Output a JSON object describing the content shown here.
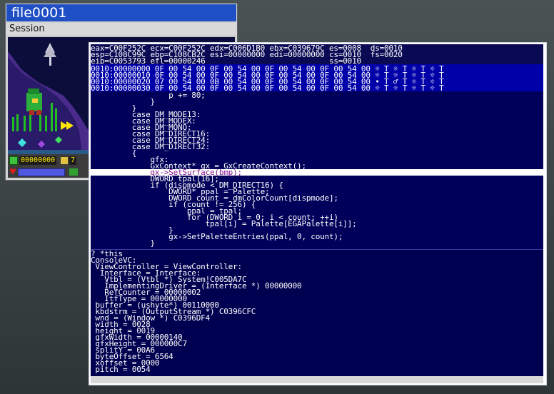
{
  "back_window": {
    "title": "file0001",
    "menu_label": "Session",
    "hud": {
      "score_left": "00000000",
      "score_right": "7"
    }
  },
  "debugger": {
    "registers": [
      "eax=C00F252C ecx=C00F252C edx=C006D1B0 ebx=C039679C es=0008  ds=0010",
      "esp=C108C99C ebp=C108CB2C esi=00000000 edi=00000000 cs=0010  fs=0020",
      "eip=C0053793 efl=00000246                           ss=0010"
    ],
    "memory": [
      "0010:00000000 0F 00 54 00 0F 00 54 00 0F 00 54 00 0F 00 54 00 ☼ T ☼ T ☼ T ☼ T",
      "0010:00000010 0F 00 54 00 0F 00 54 00 0F 00 54 00 0F 00 54 00 ☼ T ☼ T ☼ T ☼ T",
      "0010:00000020 07 00 54 00 0B 00 54 00 0F 00 54 00 0F 00 54 00 • T ♂ T ☼ T ☼ T",
      "0010:00000030 0F 00 54 00 0F 00 54 00 0F 00 54 00 0F 00 54 00 ☼ T ☼ T ☼ T ☼ T"
    ],
    "source": [
      "                 p += 80;",
      "             }",
      "         }",
      "         case DM_MODE13:",
      "         case DM_MODEX:",
      "         case DM_MONO:",
      "         case DM_DIRECT16:",
      "         case DM_DIRECT24:",
      "         case DM_DIRECT32:",
      "         {",
      "             gfx:",
      "             GxContext* gx = GxCreateContext();",
      "             gx->SetSurface(bmp);",
      "             DWORD tpal[16];",
      "             if (dispmode < DM_DIRECT16) {",
      "                 DWORD* ppal = Palette;",
      "                 DWORD count = dmColorCount[dispmode];",
      "                 if (count != 256) {",
      "                     ppal = tpal;",
      "                     for (DWORD i = 0; i < count; ++i)",
      "                         tpal[i] = Palette[EGAPalette[i]];",
      "                 }",
      "                 gx->SetPaletteEntries(ppal, 0, count);",
      "             }"
    ],
    "highlighted_line": 12,
    "console": [
      "? *this",
      "ConsoleVC:",
      " ViewController = ViewController:",
      "  Interface = Interface:",
      "   Vtbl = (Vtbl *) System!C005DA7C",
      "   ImplementingDriver = (Interface *) 00000000",
      "   RefCounter = 00000002",
      "   ItfType = 00000000",
      " buffer = (ushyte*) 00110000",
      " kbdstrm = (OutputStream *) C0396CFC",
      " wnd = (Window *) C0396DF4",
      " width = 0028",
      " height = 0019",
      " gfxWidth = 00000140",
      " gfxHeight = 000000C7",
      " splitY = 00A6",
      " byteOffset = 6564",
      " xoffset = 0000",
      " pitch = 0054"
    ]
  },
  "colors": {
    "title_blue": "#1f4fc4",
    "source_bg": "#00005a",
    "memory_bg": "#0000a8",
    "highlight_text": "#8a1696"
  }
}
